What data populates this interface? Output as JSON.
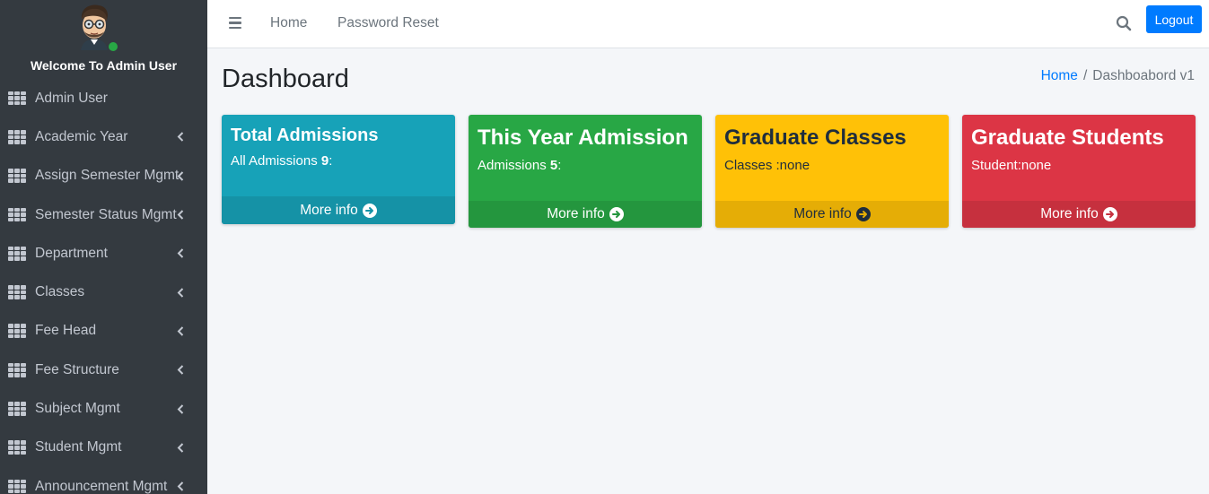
{
  "sidebar": {
    "welcome": "Welcome To Admin User",
    "items": [
      {
        "label": "Admin User",
        "expandable": false
      },
      {
        "label": "Academic Year",
        "expandable": true
      },
      {
        "label": "Assign Semester Mgmt",
        "expandable": true
      },
      {
        "label": "Semester Status Mgmt",
        "expandable": true
      },
      {
        "label": "Department",
        "expandable": true
      },
      {
        "label": "Classes",
        "expandable": true
      },
      {
        "label": "Fee Head",
        "expandable": true
      },
      {
        "label": "Fee Structure",
        "expandable": true
      },
      {
        "label": "Subject Mgmt",
        "expandable": true
      },
      {
        "label": "Student Mgmt",
        "expandable": true
      },
      {
        "label": "Announcement Mgmt",
        "expandable": true
      }
    ]
  },
  "topbar": {
    "home": "Home",
    "password_reset": "Password Reset",
    "logout": "Logout"
  },
  "header": {
    "title": "Dashboard",
    "breadcrumb_home": "Home",
    "breadcrumb_separator": "/",
    "breadcrumb_current": "Dashboabord v1"
  },
  "boxes": [
    {
      "title": "Total Admissions",
      "text_prefix": "All Admissions ",
      "text_value": "9",
      "text_suffix": ":",
      "more": "More info",
      "color": "#17a2b8"
    },
    {
      "title": "This Year Admission",
      "text_prefix": "Admissions ",
      "text_value": "5",
      "text_suffix": ":",
      "more": "More info",
      "color": "#28a745"
    },
    {
      "title": "Graduate Classes",
      "text": "Classes :none",
      "more": "More info",
      "color": "#ffc107"
    },
    {
      "title": "Graduate Students",
      "text": "Student:none",
      "more": "More info",
      "color": "#dc3545"
    }
  ]
}
